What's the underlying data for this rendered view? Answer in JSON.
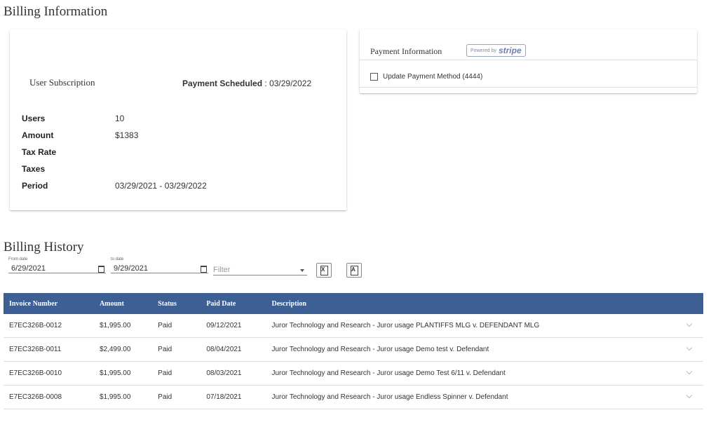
{
  "billing_info": {
    "title": "Billing Information",
    "subscription": {
      "title": "User Subscription",
      "scheduled_label": "Payment Scheduled",
      "scheduled_sep": " : ",
      "scheduled_date": "03/29/2022",
      "rows": [
        {
          "label": "Users",
          "value": "10"
        },
        {
          "label": "Amount",
          "value": "$1383"
        },
        {
          "label": "Tax Rate",
          "value": ""
        },
        {
          "label": "Taxes",
          "value": ""
        },
        {
          "label": "Period",
          "value": "03/29/2021 - 03/29/2022"
        }
      ]
    },
    "payment": {
      "title": "Payment Information",
      "powered_by": "Powered by",
      "brand": "stripe",
      "update_label": "Update Payment Method (4444)"
    }
  },
  "billing_history": {
    "title": "Billing History",
    "from": {
      "label": "From date",
      "value": "6/29/2021"
    },
    "to": {
      "label": "to date",
      "value": "9/29/2021"
    },
    "filter": {
      "placeholder": "Filter"
    },
    "export_excel_glyph": "X",
    "export_pdf_glyph": "A",
    "columns": [
      "Invoice Number",
      "Amount",
      "Status",
      "Paid Date",
      "Description"
    ],
    "rows": [
      {
        "invoice": "E7EC326B-0012",
        "amount": "$1,995.00",
        "status": "Paid",
        "paid_date": "09/12/2021",
        "description": "Juror Technology and Research - Juror usage PLANTIFFS MLG v. DEFENDANT MLG"
      },
      {
        "invoice": "E7EC326B-0011",
        "amount": "$2,499.00",
        "status": "Paid",
        "paid_date": "08/04/2021",
        "description": "Juror Technology and Research - Juror usage Demo test v. Defendant"
      },
      {
        "invoice": "E7EC326B-0010",
        "amount": "$1,995.00",
        "status": "Paid",
        "paid_date": "08/03/2021",
        "description": "Juror Technology and Research - Juror usage Demo Test 6/11 v. Defendant"
      },
      {
        "invoice": "E7EC326B-0008",
        "amount": "$1,995.00",
        "status": "Paid",
        "paid_date": "07/18/2021",
        "description": "Juror Technology and Research - Juror usage Endless Spinner v. Defendant"
      }
    ]
  },
  "colors": {
    "table_header": "#3d5f93"
  }
}
